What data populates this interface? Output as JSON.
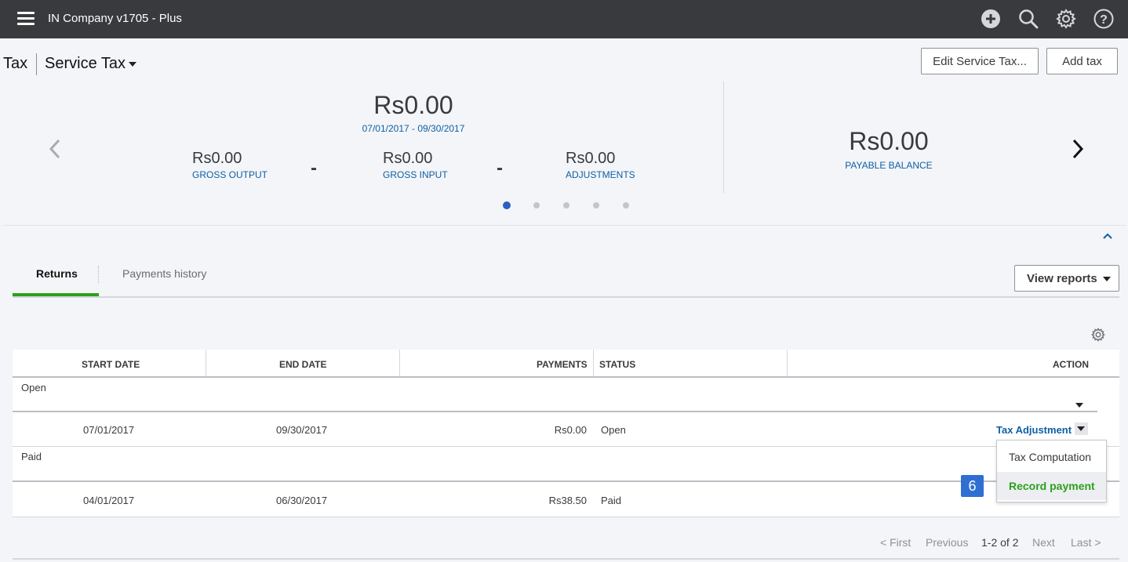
{
  "topbar": {
    "app_title": "IN Company v1705 - Plus",
    "icons": [
      "menu-icon",
      "plus-circle-icon",
      "search-icon",
      "gear-icon",
      "help-icon"
    ]
  },
  "header": {
    "page_title": "Tax",
    "tax_select": "Service Tax",
    "edit_button": "Edit Service Tax...",
    "add_button": "Add tax"
  },
  "summary": {
    "total_amount": "Rs0.00",
    "period": "07/01/2017 - 09/30/2017",
    "gross_output_amount": "Rs0.00",
    "gross_output_label": "GROSS OUTPUT",
    "gross_input_amount": "Rs0.00",
    "gross_input_label": "GROSS INPUT",
    "adjustments_amount": "Rs0.00",
    "adjustments_label": "ADJUSTMENTS",
    "operator_1": "-",
    "operator_2": "-",
    "payable_amount": "Rs0.00",
    "payable_label": "PAYABLE BALANCE",
    "carousel_pages": 5,
    "carousel_active": 1
  },
  "tabs": {
    "returns": "Returns",
    "payments_history": "Payments history",
    "view_reports": "View reports"
  },
  "table": {
    "headers": {
      "start_date": "START DATE",
      "end_date": "END DATE",
      "payments": "PAYMENTS",
      "status": "STATUS",
      "action": "ACTION"
    },
    "groups": [
      {
        "label": "Open",
        "rows": [
          {
            "start": "07/01/2017",
            "end": "09/30/2017",
            "payments": "Rs0.00",
            "status": "Open",
            "action": "Tax Adjustment"
          }
        ]
      },
      {
        "label": "Paid",
        "rows": [
          {
            "start": "04/01/2017",
            "end": "06/30/2017",
            "payments": "Rs38.50",
            "status": "Paid"
          }
        ]
      }
    ]
  },
  "action_menu": {
    "items": [
      "Tax Computation",
      "Record payment"
    ],
    "highlighted": "Record payment",
    "highlight_color": "#2ca01c"
  },
  "step_badge": "6",
  "pagination": {
    "first": "< First",
    "previous": "Previous",
    "range": "1-2 of 2",
    "next": "Next",
    "last": "Last >"
  },
  "colors": {
    "topbar": "#393a3d",
    "link": "#0d5fa6",
    "accent_green": "#2ca01c",
    "badge": "#2f6fd2"
  }
}
